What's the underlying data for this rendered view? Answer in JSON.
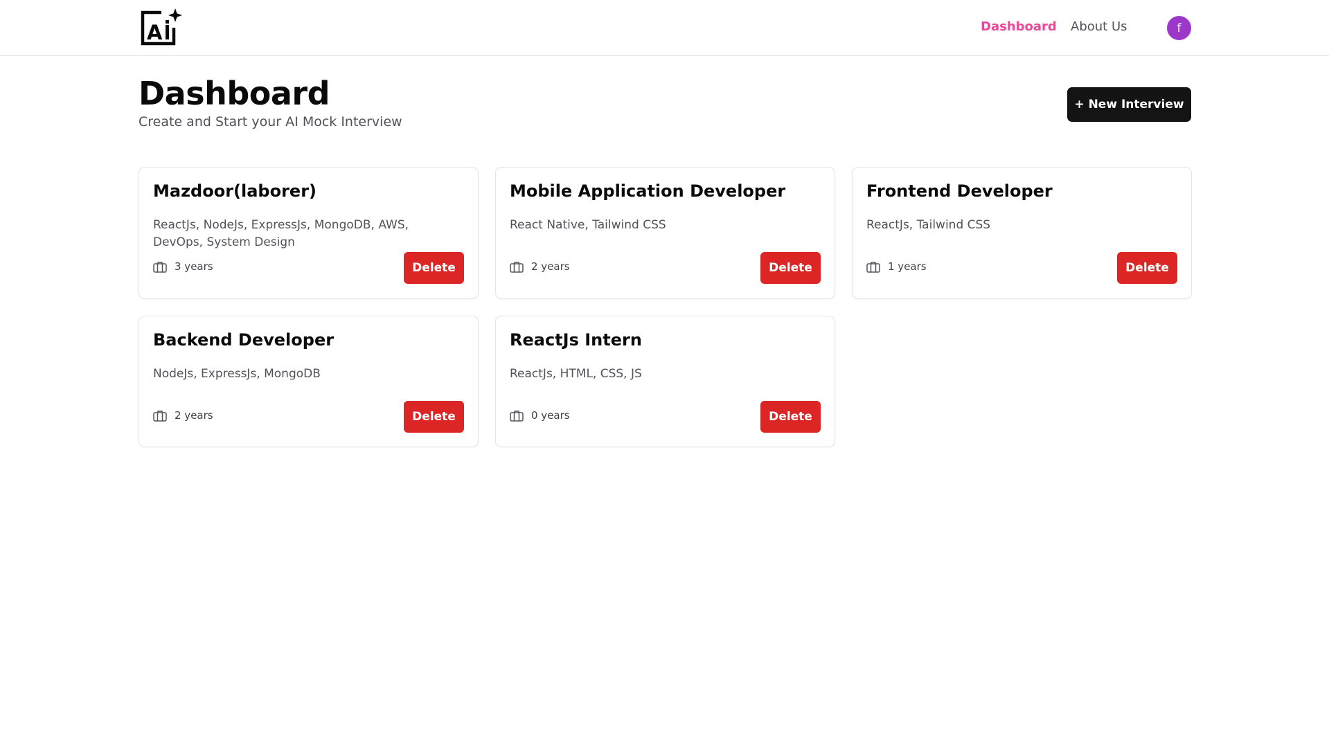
{
  "header": {
    "logo_text": "AI",
    "nav": {
      "dashboard": "Dashboard",
      "about": "About Us"
    },
    "avatar_initial": "f"
  },
  "page": {
    "title": "Dashboard",
    "subtitle": "Create and Start your AI Mock Interview",
    "new_button": "+ New Interview"
  },
  "interviews": [
    {
      "title": "Mazdoor(laborer)",
      "stack": "ReactJs, NodeJs, ExpressJs, MongoDB, AWS, DevOps, System Design",
      "experience": "3 years",
      "delete_label": "Delete"
    },
    {
      "title": "Mobile Application Developer",
      "stack": "React Native, Tailwind CSS",
      "experience": "2 years",
      "delete_label": "Delete"
    },
    {
      "title": "Frontend Developer",
      "stack": "ReactJs, Tailwind CSS",
      "experience": "1 years",
      "delete_label": "Delete"
    },
    {
      "title": "Backend Developer",
      "stack": "NodeJs, ExpressJs, MongoDB",
      "experience": "2 years",
      "delete_label": "Delete"
    },
    {
      "title": "ReactJs Intern",
      "stack": "ReactJs, HTML, CSS, JS",
      "experience": "0 years",
      "delete_label": "Delete"
    }
  ],
  "icons": {
    "logo": "ai-sparkle-icon",
    "experience": "briefcase-icon"
  },
  "colors": {
    "accent": "#ec4899",
    "avatar": "#9b37c9",
    "primary_button": "#141414",
    "danger": "#dc2626"
  }
}
